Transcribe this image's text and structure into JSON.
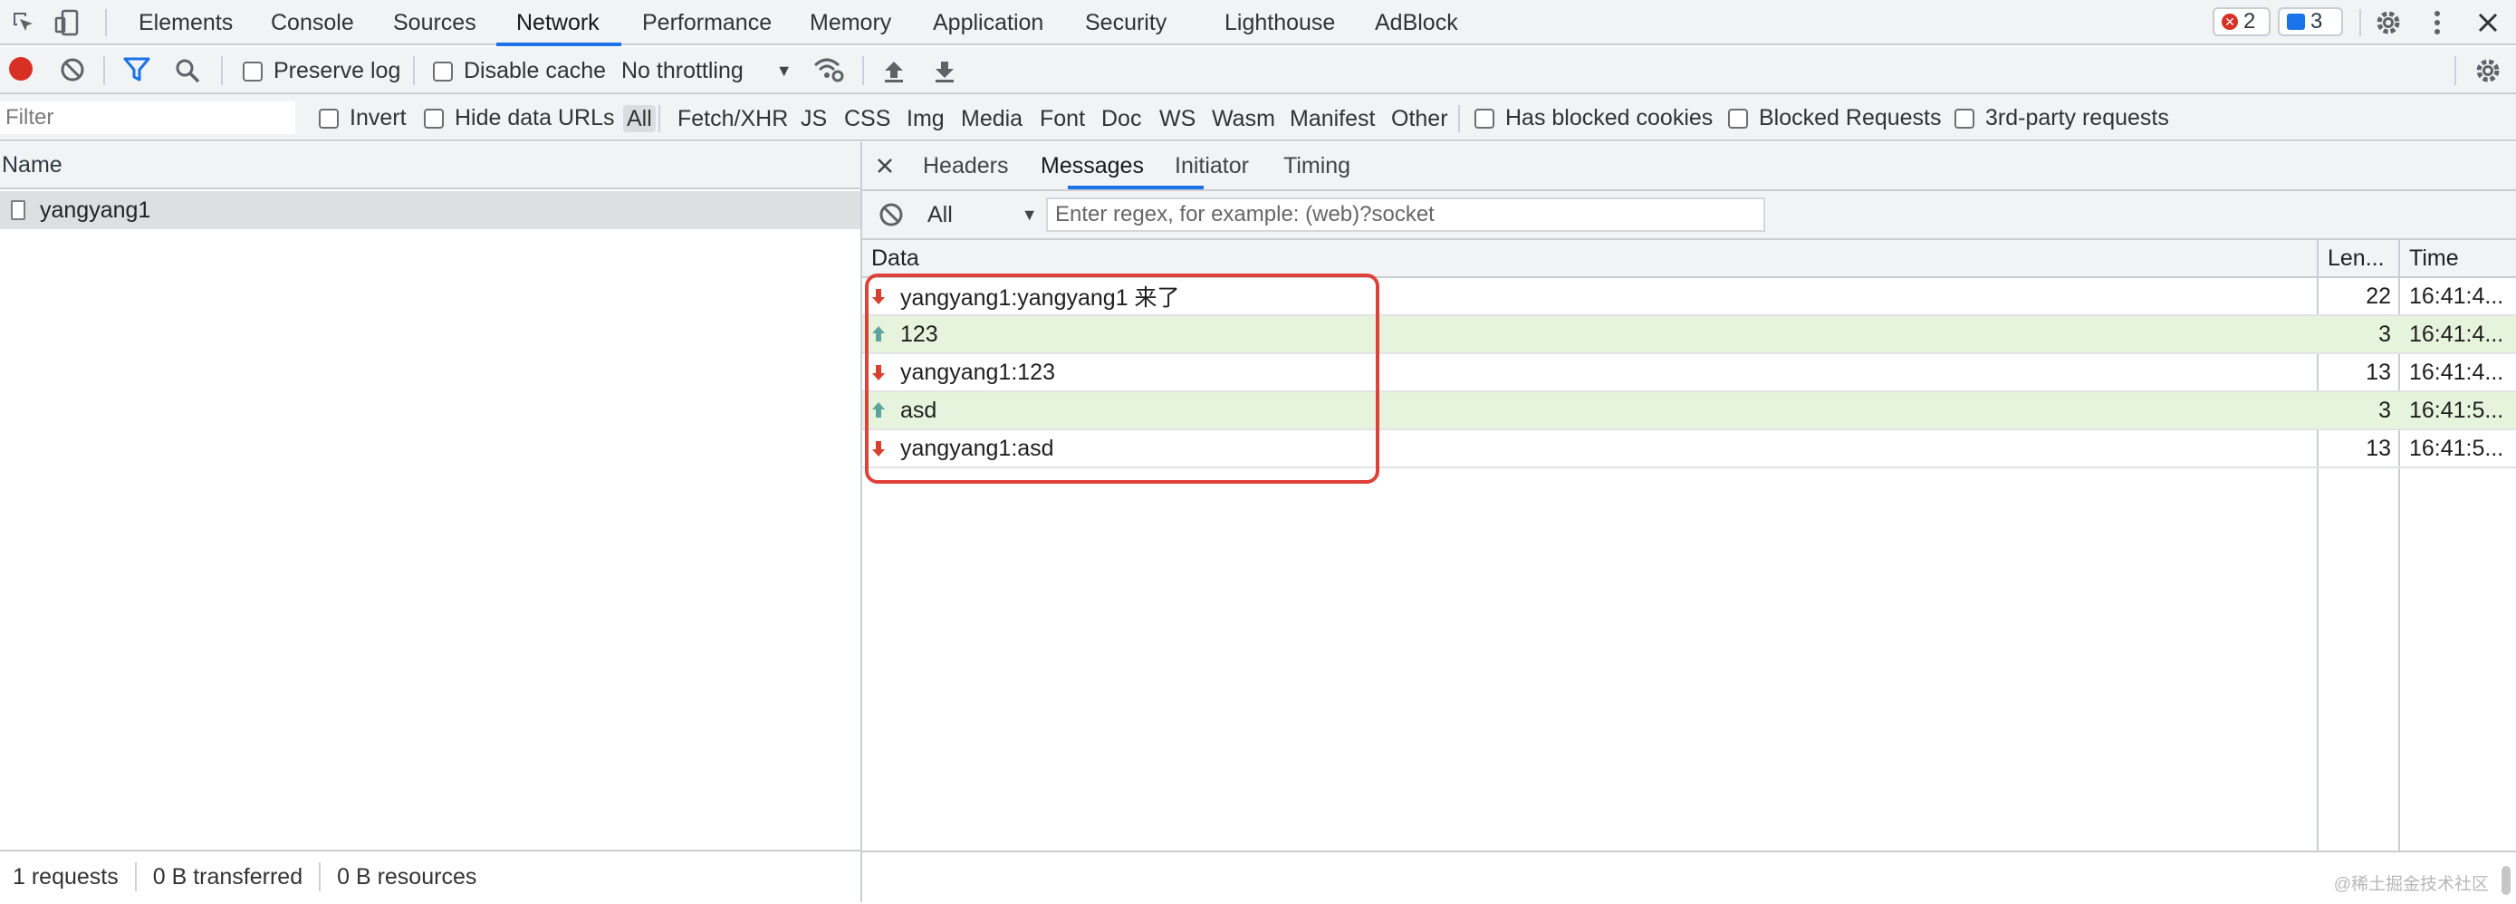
{
  "topbar": {
    "tabs": [
      "Elements",
      "Console",
      "Sources",
      "Network",
      "Performance",
      "Memory",
      "Application",
      "Security",
      "Lighthouse",
      "AdBlock"
    ],
    "active_tab": "Network",
    "error_count": "2",
    "message_count": "3",
    "colors": {
      "accent": "#1a73e8",
      "error": "#d93025"
    }
  },
  "toolbar": {
    "preserve_log": "Preserve log",
    "disable_cache": "Disable cache",
    "throttling": "No throttling"
  },
  "filterbar": {
    "filter_placeholder": "Filter",
    "invert": "Invert",
    "hide_data_urls": "Hide data URLs",
    "types": [
      "All",
      "Fetch/XHR",
      "JS",
      "CSS",
      "Img",
      "Media",
      "Font",
      "Doc",
      "WS",
      "Wasm",
      "Manifest",
      "Other"
    ],
    "has_blocked_cookies": "Has blocked cookies",
    "blocked_requests": "Blocked Requests",
    "third_party": "3rd-party requests"
  },
  "requests": {
    "header": "Name",
    "items": [
      {
        "name": "yangyang1"
      }
    ]
  },
  "status": {
    "requests": "1 requests",
    "transferred": "0 B transferred",
    "resources": "0 B resources"
  },
  "detail": {
    "tabs": [
      "Headers",
      "Messages",
      "Initiator",
      "Timing"
    ],
    "active_tab": "Messages",
    "message_filter": "All",
    "regex_placeholder": "Enter regex, for example: (web)?socket",
    "columns": [
      "Data",
      "Len...",
      "Time"
    ],
    "messages": [
      {
        "direction": "received",
        "data": "yangyang1:yangyang1 来了",
        "length": "22",
        "time": "16:41:4..."
      },
      {
        "direction": "sent",
        "data": "123",
        "length": "3",
        "time": "16:41:4..."
      },
      {
        "direction": "received",
        "data": "yangyang1:123",
        "length": "13",
        "time": "16:41:4..."
      },
      {
        "direction": "sent",
        "data": "asd",
        "length": "3",
        "time": "16:41:5..."
      },
      {
        "direction": "received",
        "data": "yangyang1:asd",
        "length": "13",
        "time": "16:41:5..."
      }
    ],
    "colors": {
      "received_arrow": "#d9402f",
      "sent_arrow": "#5fa39b",
      "sent_row": "#e6f4de",
      "highlight": "#e0403a"
    }
  },
  "watermark": "@稀土掘金技术社区"
}
